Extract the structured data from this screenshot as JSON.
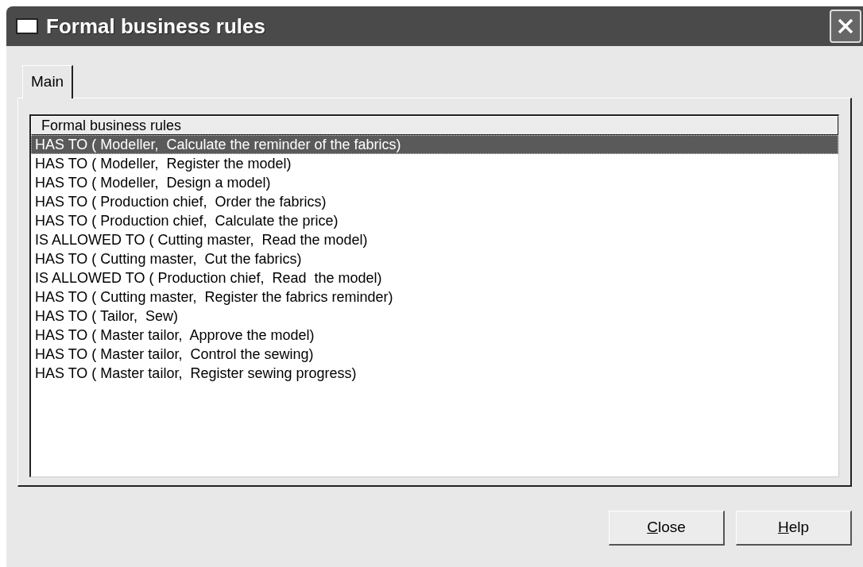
{
  "window": {
    "title": "Formal business rules"
  },
  "tabs": [
    {
      "label": "Main",
      "selected": true
    }
  ],
  "list": {
    "column": "Formal business rules",
    "rows": [
      {
        "text": "HAS TO ( Modeller,  Calculate the reminder of the fabrics)",
        "selected": true
      },
      {
        "text": "HAS TO ( Modeller,  Register the model)",
        "selected": false
      },
      {
        "text": "HAS TO ( Modeller,  Design a model)",
        "selected": false
      },
      {
        "text": "HAS TO ( Production chief,  Order the fabrics)",
        "selected": false
      },
      {
        "text": "HAS TO ( Production chief,  Calculate the price)",
        "selected": false
      },
      {
        "text": "IS ALLOWED TO ( Cutting master,  Read the model)",
        "selected": false
      },
      {
        "text": "HAS TO ( Cutting master,  Cut the fabrics)",
        "selected": false
      },
      {
        "text": "IS ALLOWED TO ( Production chief,  Read  the model)",
        "selected": false
      },
      {
        "text": "HAS TO ( Cutting master,  Register the fabrics reminder)",
        "selected": false
      },
      {
        "text": "HAS TO ( Tailor,  Sew)",
        "selected": false
      },
      {
        "text": "HAS TO ( Master tailor,  Approve the model)",
        "selected": false
      },
      {
        "text": "HAS TO ( Master tailor,  Control the sewing)",
        "selected": false
      },
      {
        "text": "HAS TO ( Master tailor,  Register sewing progress)",
        "selected": false
      }
    ]
  },
  "buttons": [
    "Close",
    "Help"
  ]
}
